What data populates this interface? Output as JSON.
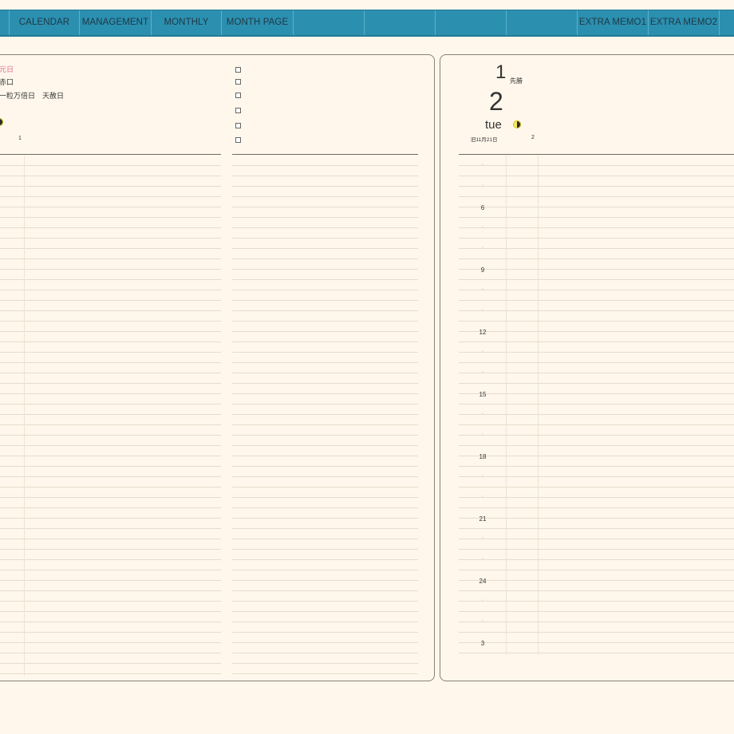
{
  "nav": {
    "tabs": [
      {
        "label": ""
      },
      {
        "label": "CALENDAR"
      },
      {
        "label": "MANAGEMENT"
      },
      {
        "label": "MONTHLY"
      },
      {
        "label": "MONTH PAGE"
      },
      {
        "label": ""
      },
      {
        "label": ""
      },
      {
        "label": ""
      },
      {
        "label": "EXTRA MEMO1"
      },
      {
        "label": "EXTRA MEMO2"
      }
    ]
  },
  "left_page": {
    "holiday": "元日",
    "line2": "赤口",
    "line3": "一粒万倍日　天赦日",
    "day_number": "1"
  },
  "right_page": {
    "day_prev": "1",
    "rokuyo": "先勝",
    "day": "2",
    "weekday": "tue",
    "lunar": "旧11月21日",
    "day_number": "2",
    "hours": [
      "◦",
      "◦",
      "6",
      "◦",
      "◦",
      "9",
      "◦",
      "◦",
      "12",
      "◦",
      "◦",
      "15",
      "◦",
      "◦",
      "18",
      "◦",
      "◦",
      "21",
      "◦",
      "◦",
      "24",
      "◦",
      "◦",
      "3"
    ]
  }
}
